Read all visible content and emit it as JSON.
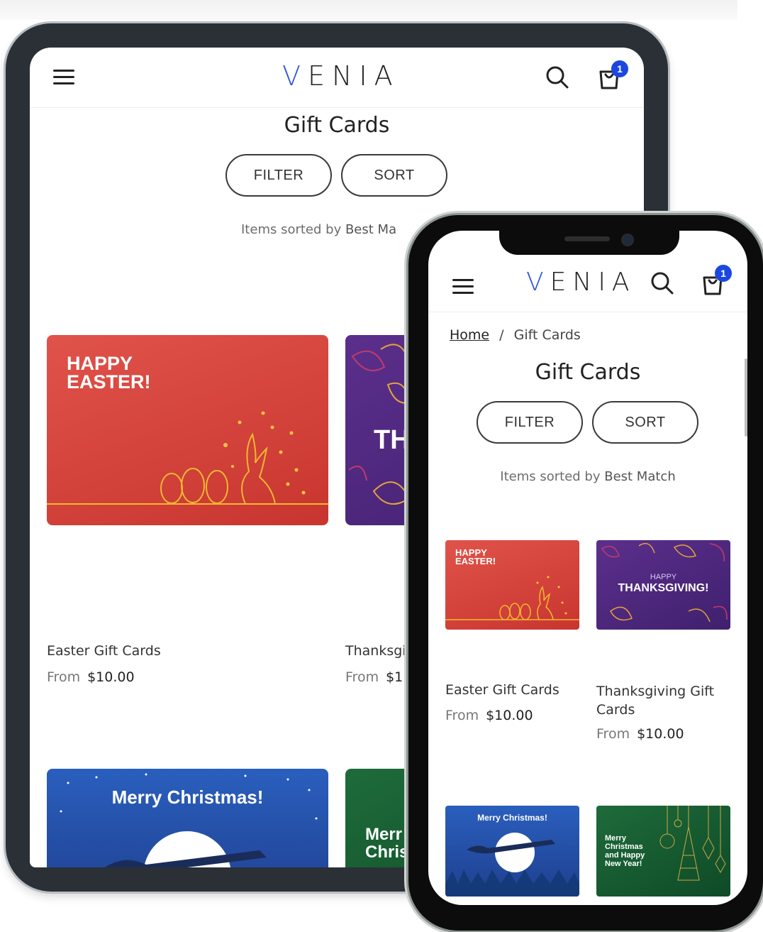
{
  "brand": {
    "logo_first": "V",
    "logo_rest": "ENIA",
    "cart_count": "1"
  },
  "icons": {
    "menu": "hamburger-icon",
    "search": "search-icon",
    "cart": "shopping-bag-icon"
  },
  "colors": {
    "accent": "#1b47e0",
    "logo_v": "#2f57d6",
    "easter": "#d84a42",
    "thanksgiving": "#4e2880",
    "christmas": "#2653b0",
    "newyear": "#175a30"
  },
  "page": {
    "title": "Gift Cards",
    "filter_label": "FILTER",
    "sort_label": "SORT",
    "sorted_prefix": "Items sorted by ",
    "sorted_value": "Best Match"
  },
  "tablet": {
    "sorted_visible": "Best Ma",
    "thanks_name_visible": "Thanksgi",
    "thanks_price_visible": "$1"
  },
  "breadcrumb": {
    "home": "Home",
    "separator": "/",
    "current": "Gift Cards"
  },
  "products": [
    {
      "name": "Easter Gift Cards",
      "from_label": "From",
      "price": "$10.00",
      "card_text": [
        "HAPPY",
        "EASTER!"
      ]
    },
    {
      "name_line1": "Thanksgiving Gift",
      "name_line2": "Cards",
      "from_label": "From",
      "price": "$10.00",
      "card_text_small": "HAPPY",
      "card_text": "THANKSGIVING!",
      "tablet_card_text": "TH"
    },
    {
      "card_text": "Merry Christmas!"
    },
    {
      "card_text": [
        "Merry",
        "Christmas",
        "and Happy",
        "New Year!"
      ],
      "tablet_card_text": [
        "Merr",
        "Chris"
      ]
    }
  ]
}
